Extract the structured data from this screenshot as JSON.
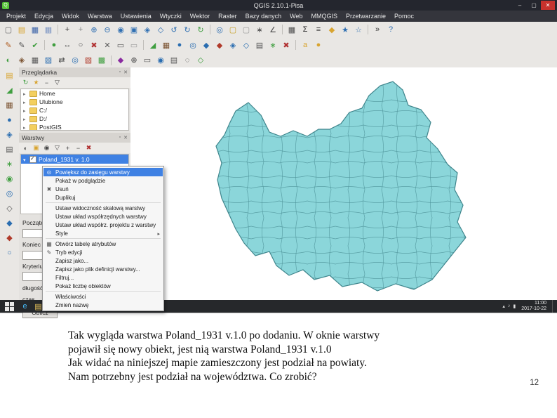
{
  "slide": {
    "caption_lines": [
      "Tak wygląda warstwa Poland_1931 v.1.0 po dodaniu. W oknie warstwy",
      "pojawił się nowy obiekt, jest nią warstwa Poland_1931 v.1.0",
      "Jak widać na niniejszej mapie zamieszczony jest podział na powiaty.",
      "Nam potrzebny jest podział na województwa. Co zrobić?"
    ],
    "page_number": "12"
  },
  "window": {
    "title": "QGIS 2.10.1-Pisa",
    "app_icon_glyph": "Q",
    "controls": {
      "minimize": "–",
      "maximize": "▢",
      "close": "✕"
    }
  },
  "chrome": {
    "dock_float": "▫",
    "dock_close": "✕",
    "capture_glyph": "+"
  },
  "menu": {
    "items": [
      "Projekt",
      "Edycja",
      "Widok",
      "Warstwa",
      "Ustawienia",
      "Wtyczki",
      "Wektor",
      "Raster",
      "Bazy danych",
      "Web",
      "MMQGIS",
      "Przetwarzanie",
      "Pomoc"
    ]
  },
  "toolbars": {
    "row1": [
      {
        "name": "new-project-icon",
        "glyph": "▢",
        "color": "#6b6b6b"
      },
      {
        "name": "open-project-icon",
        "glyph": "▤",
        "color": "#d8a430"
      },
      {
        "name": "save-project-icon",
        "glyph": "▦",
        "color": "#3a62a8"
      },
      {
        "name": "save-project-as-icon",
        "glyph": "▦",
        "color": "#7e97c4"
      },
      {
        "glyph": "|"
      },
      {
        "name": "pan-map-icon",
        "glyph": "+",
        "color": "#3b3b3b"
      },
      {
        "name": "pan-to-selection-icon",
        "glyph": "+",
        "color": "#8a8a8a"
      },
      {
        "name": "zoom-in-icon",
        "glyph": "⊕",
        "color": "#2f6fb2"
      },
      {
        "name": "zoom-out-icon",
        "glyph": "⊖",
        "color": "#2f6fb2"
      },
      {
        "name": "zoom-actual-icon",
        "glyph": "◉",
        "color": "#2f6fb2"
      },
      {
        "name": "zoom-full-icon",
        "glyph": "▣",
        "color": "#2f6fb2"
      },
      {
        "name": "zoom-to-selection-icon",
        "glyph": "◈",
        "color": "#2f6fb2"
      },
      {
        "name": "zoom-to-layer-icon",
        "glyph": "◇",
        "color": "#2f6fb2"
      },
      {
        "name": "zoom-last-icon",
        "glyph": "↺",
        "color": "#2f6fb2"
      },
      {
        "name": "zoom-next-icon",
        "glyph": "↻",
        "color": "#2f6fb2"
      },
      {
        "name": "refresh-map-icon",
        "glyph": "↻",
        "color": "#3f9e3f"
      },
      {
        "glyph": "|"
      },
      {
        "name": "identify-features-icon",
        "glyph": "◎",
        "color": "#2f6fb2"
      },
      {
        "name": "select-features-icon",
        "glyph": "▢",
        "color": "#c8a22a"
      },
      {
        "name": "deselect-features-icon",
        "glyph": "▢",
        "color": "#9a9a9a"
      },
      {
        "name": "select-by-expression-icon",
        "glyph": "∗",
        "color": "#444444"
      },
      {
        "name": "measure-line-icon",
        "glyph": "∠",
        "color": "#444444"
      },
      {
        "glyph": "|"
      },
      {
        "name": "attribute-table-icon",
        "glyph": "▦",
        "color": "#4a4a4a"
      },
      {
        "name": "field-calculator-icon",
        "glyph": "Σ",
        "color": "#222222"
      },
      {
        "name": "statistics-icon",
        "glyph": "≡",
        "color": "#444444"
      },
      {
        "name": "map-tips-icon",
        "glyph": "◆",
        "color": "#d8a430"
      },
      {
        "name": "bookmarks-icon",
        "glyph": "★",
        "color": "#2f6fb2"
      },
      {
        "name": "new-bookmark-icon",
        "glyph": "☆",
        "color": "#2f6fb2"
      },
      {
        "glyph": "|"
      },
      {
        "name": "python-console-icon",
        "glyph": "»",
        "color": "#3b3b3b"
      },
      {
        "name": "help-icon",
        "glyph": "?",
        "color": "#2f6fb2"
      }
    ],
    "row2": [
      {
        "name": "current-edits-icon",
        "glyph": "✎",
        "color": "#b05c20"
      },
      {
        "name": "toggle-editing-icon",
        "glyph": "✎",
        "color": "#555555"
      },
      {
        "name": "save-edits-icon",
        "glyph": "✔",
        "color": "#3f9e3f"
      },
      {
        "glyph": "|"
      },
      {
        "name": "add-feature-icon",
        "glyph": "●",
        "color": "#3f9e3f"
      },
      {
        "name": "move-feature-icon",
        "glyph": "↔",
        "color": "#444444"
      },
      {
        "name": "node-tool-icon",
        "glyph": "○",
        "color": "#444444"
      },
      {
        "name": "delete-selected-icon",
        "glyph": "✖",
        "color": "#b03030"
      },
      {
        "name": "cut-features-icon",
        "glyph": "✕",
        "color": "#555555"
      },
      {
        "name": "copy-features-icon",
        "glyph": "▭",
        "color": "#555555"
      },
      {
        "name": "paste-features-icon",
        "glyph": "▭",
        "color": "#999999"
      },
      {
        "glyph": "|"
      },
      {
        "name": "add-vector-layer-icon",
        "glyph": "◢",
        "color": "#3f9e3f"
      },
      {
        "name": "add-raster-layer-icon",
        "glyph": "▦",
        "color": "#7a5230"
      },
      {
        "name": "add-postgis-layer-icon",
        "glyph": "●",
        "color": "#2a6db0"
      },
      {
        "name": "add-spatialite-layer-icon",
        "glyph": "◎",
        "color": "#2a6db0"
      },
      {
        "name": "add-mssql-layer-icon",
        "glyph": "◆",
        "color": "#2a6db0"
      },
      {
        "name": "add-oracle-layer-icon",
        "glyph": "◆",
        "color": "#b03a2a"
      },
      {
        "name": "add-wms-layer-icon",
        "glyph": "◈",
        "color": "#2a6db0"
      },
      {
        "name": "add-wfs-layer-icon",
        "glyph": "◇",
        "color": "#2a6db0"
      },
      {
        "name": "add-delimited-text-icon",
        "glyph": "▤",
        "color": "#555555"
      },
      {
        "name": "new-shapefile-icon",
        "glyph": "∗",
        "color": "#3f9e3f"
      },
      {
        "name": "remove-layer-icon",
        "glyph": "✖",
        "color": "#b03030"
      },
      {
        "glyph": "|"
      },
      {
        "name": "labeling-icon",
        "glyph": "a",
        "color": "#d8a430"
      },
      {
        "name": "diagram-icon",
        "glyph": "●",
        "color": "#d8a430"
      }
    ],
    "row3": [
      {
        "name": "grass-tools-icon",
        "glyph": "◐",
        "color": "#3f9e3f"
      },
      {
        "name": "georeferencer-icon",
        "glyph": "◈",
        "color": "#7a5230"
      },
      {
        "name": "raster-calculator-icon",
        "glyph": "▦",
        "color": "#555555"
      },
      {
        "name": "interpolation-icon",
        "glyph": "▨",
        "color": "#2a6db0"
      },
      {
        "name": "road-graph-icon",
        "glyph": "⇄",
        "color": "#444444"
      },
      {
        "name": "spatial-query-icon",
        "glyph": "◎",
        "color": "#2a6db0"
      },
      {
        "name": "topology-checker-icon",
        "glyph": "▧",
        "color": "#b03a2a"
      },
      {
        "name": "zonal-statistics-icon",
        "glyph": "▩",
        "color": "#3f9e3f"
      },
      {
        "glyph": "|"
      },
      {
        "name": "mmqgis-icon",
        "glyph": "◆",
        "color": "#8a2aa0"
      },
      {
        "name": "coordinate-capture-icon",
        "glyph": "⊕",
        "color": "#444444"
      },
      {
        "name": "dxf-export-icon",
        "glyph": "▭",
        "color": "#555555"
      },
      {
        "name": "gps-tools-icon",
        "glyph": "◉",
        "color": "#2a6db0"
      },
      {
        "name": "print-composer-icon",
        "glyph": "▤",
        "color": "#555555"
      },
      {
        "name": "map-themes-icon",
        "glyph": "◌",
        "color": "#444444"
      },
      {
        "name": "plugin-manager-icon",
        "glyph": "◇",
        "color": "#3f9e3f"
      }
    ],
    "left": [
      {
        "name": "browser-panel-icon",
        "glyph": "▤",
        "color": "#d8a430"
      },
      {
        "name": "add-vector-icon",
        "glyph": "◢",
        "color": "#3f9e3f"
      },
      {
        "name": "add-raster-icon",
        "glyph": "▦",
        "color": "#7a5230"
      },
      {
        "name": "add-database-icon",
        "glyph": "●",
        "color": "#2a6db0"
      },
      {
        "name": "add-wms-icon",
        "glyph": "◈",
        "color": "#2a6db0"
      },
      {
        "name": "add-text-layer-icon",
        "glyph": "▤",
        "color": "#555555"
      },
      {
        "name": "new-layer-icon",
        "glyph": "∗",
        "color": "#3f9e3f"
      },
      {
        "name": "osm-layer-icon",
        "glyph": "◉",
        "color": "#3f9e3f"
      },
      {
        "name": "gps-icon",
        "glyph": "◎",
        "color": "#2a6db0"
      },
      {
        "name": "virtual-layer-icon",
        "glyph": "◇",
        "color": "#555555"
      },
      {
        "name": "spatialite-icon",
        "glyph": "◆",
        "color": "#2a6db0"
      },
      {
        "name": "oracle-icon",
        "glyph": "◆",
        "color": "#b03a2a"
      },
      {
        "name": "web-service-icon",
        "glyph": "○",
        "color": "#2a6db0"
      }
    ]
  },
  "panels": {
    "browser": {
      "title": "Przeglądarka",
      "tools": [
        {
          "name": "refresh-browser-icon",
          "glyph": "↻",
          "color": "#3f9e3f"
        },
        {
          "name": "add-favourite-icon",
          "glyph": "★",
          "color": "#d8a430"
        },
        {
          "name": "collapse-all-icon",
          "glyph": "−",
          "color": "#444444"
        },
        {
          "name": "filter-browser-icon",
          "glyph": "▽",
          "color": "#444444"
        }
      ],
      "items": [
        "Home",
        "Ulubione",
        "C:/",
        "D:/",
        "PostGIS"
      ]
    },
    "layers": {
      "title": "Warstwy",
      "tools": [
        {
          "name": "open-layer-styling-icon",
          "glyph": "◐",
          "color": "#444444"
        },
        {
          "name": "add-group-icon",
          "glyph": "▣",
          "color": "#d8a430"
        },
        {
          "name": "manage-visibility-icon",
          "glyph": "◉",
          "color": "#444444"
        },
        {
          "name": "filter-legend-icon",
          "glyph": "▽",
          "color": "#444444"
        },
        {
          "name": "expand-all-icon",
          "glyph": "+",
          "color": "#444444"
        },
        {
          "name": "collapse-layers-icon",
          "glyph": "−",
          "color": "#444444"
        },
        {
          "name": "remove-layer-group-icon",
          "glyph": "✖",
          "color": "#b03030"
        }
      ],
      "selected_layer": "Poland_1931 v. 1.0"
    },
    "road_graph": {
      "start_label": "Początek",
      "start_value": "",
      "stop_label": "Koniec",
      "stop_value": "",
      "criterion_label": "Kryterium",
      "criterion_value": "",
      "length_label": "długość",
      "time_label": "czas",
      "calculate_label": "Oblicz"
    }
  },
  "context_menu": {
    "items": [
      {
        "label": "Powiększ do zasięgu warstwy",
        "icon": "⊙"
      },
      {
        "label": "Pokaż w podglądzie",
        "icon": ""
      },
      {
        "label": "Usuń",
        "icon": "✖"
      },
      {
        "label": "Duplikuj",
        "icon": ""
      },
      {
        "label": "Ustaw widoczność skalową warstwy",
        "icon": ""
      },
      {
        "label": "Ustaw układ współrzędnych warstwy",
        "icon": ""
      },
      {
        "label": "Ustaw układ współrz. projektu z warstwy",
        "icon": ""
      },
      {
        "label": "Style",
        "icon": ""
      },
      {
        "label": "Otwórz tabelę atrybutów",
        "icon": "▦"
      },
      {
        "label": "Tryb edycji",
        "icon": "✎"
      },
      {
        "label": "Zapisz jako...",
        "icon": ""
      },
      {
        "label": "Zapisz jako plik definicji warstwy...",
        "icon": ""
      },
      {
        "label": "Filtruj...",
        "icon": ""
      },
      {
        "label": "Pokaż liczbę obiektów",
        "icon": ""
      },
      {
        "label": "Właściwości",
        "icon": ""
      },
      {
        "label": "Zmień nazwę",
        "icon": ""
      }
    ]
  },
  "taskbar": {
    "icons": [
      {
        "name": "internet-explorer-icon",
        "glyph": "e",
        "color": "#45b6f2"
      },
      {
        "name": "file-explorer-icon",
        "glyph": "▤",
        "color": "#e8c35a"
      },
      {
        "name": "libreoffice-icon",
        "glyph": "▢",
        "color": "#cfd8e8"
      },
      {
        "name": "image-editor-icon",
        "glyph": "◆",
        "color": "#9b59b6"
      },
      {
        "name": "inkscape-icon",
        "glyph": "◗",
        "color": "#dddddd"
      },
      {
        "name": "firefox-icon",
        "glyph": "◉",
        "color": "#f07c24"
      },
      {
        "name": "qgis-taskbar-icon",
        "glyph": "Q",
        "color": "#5bc236"
      },
      {
        "name": "document-icon",
        "glyph": "▣",
        "color": "#bbbbbb"
      }
    ],
    "tray": [
      {
        "name": "tray-expand-icon",
        "glyph": "▴"
      },
      {
        "name": "volume-icon",
        "glyph": "♪"
      },
      {
        "name": "network-icon",
        "glyph": "▮"
      }
    ],
    "time": "11:00",
    "date": "2017-10-22"
  },
  "colors": {
    "selection": "#3f81e3",
    "map_fill": "#8bd6da",
    "map_stroke": "#3f858c",
    "map_line": "#4f939a",
    "close_button": "#c7322d",
    "taskbar": "#26282b",
    "titlebar": "#24262e"
  }
}
